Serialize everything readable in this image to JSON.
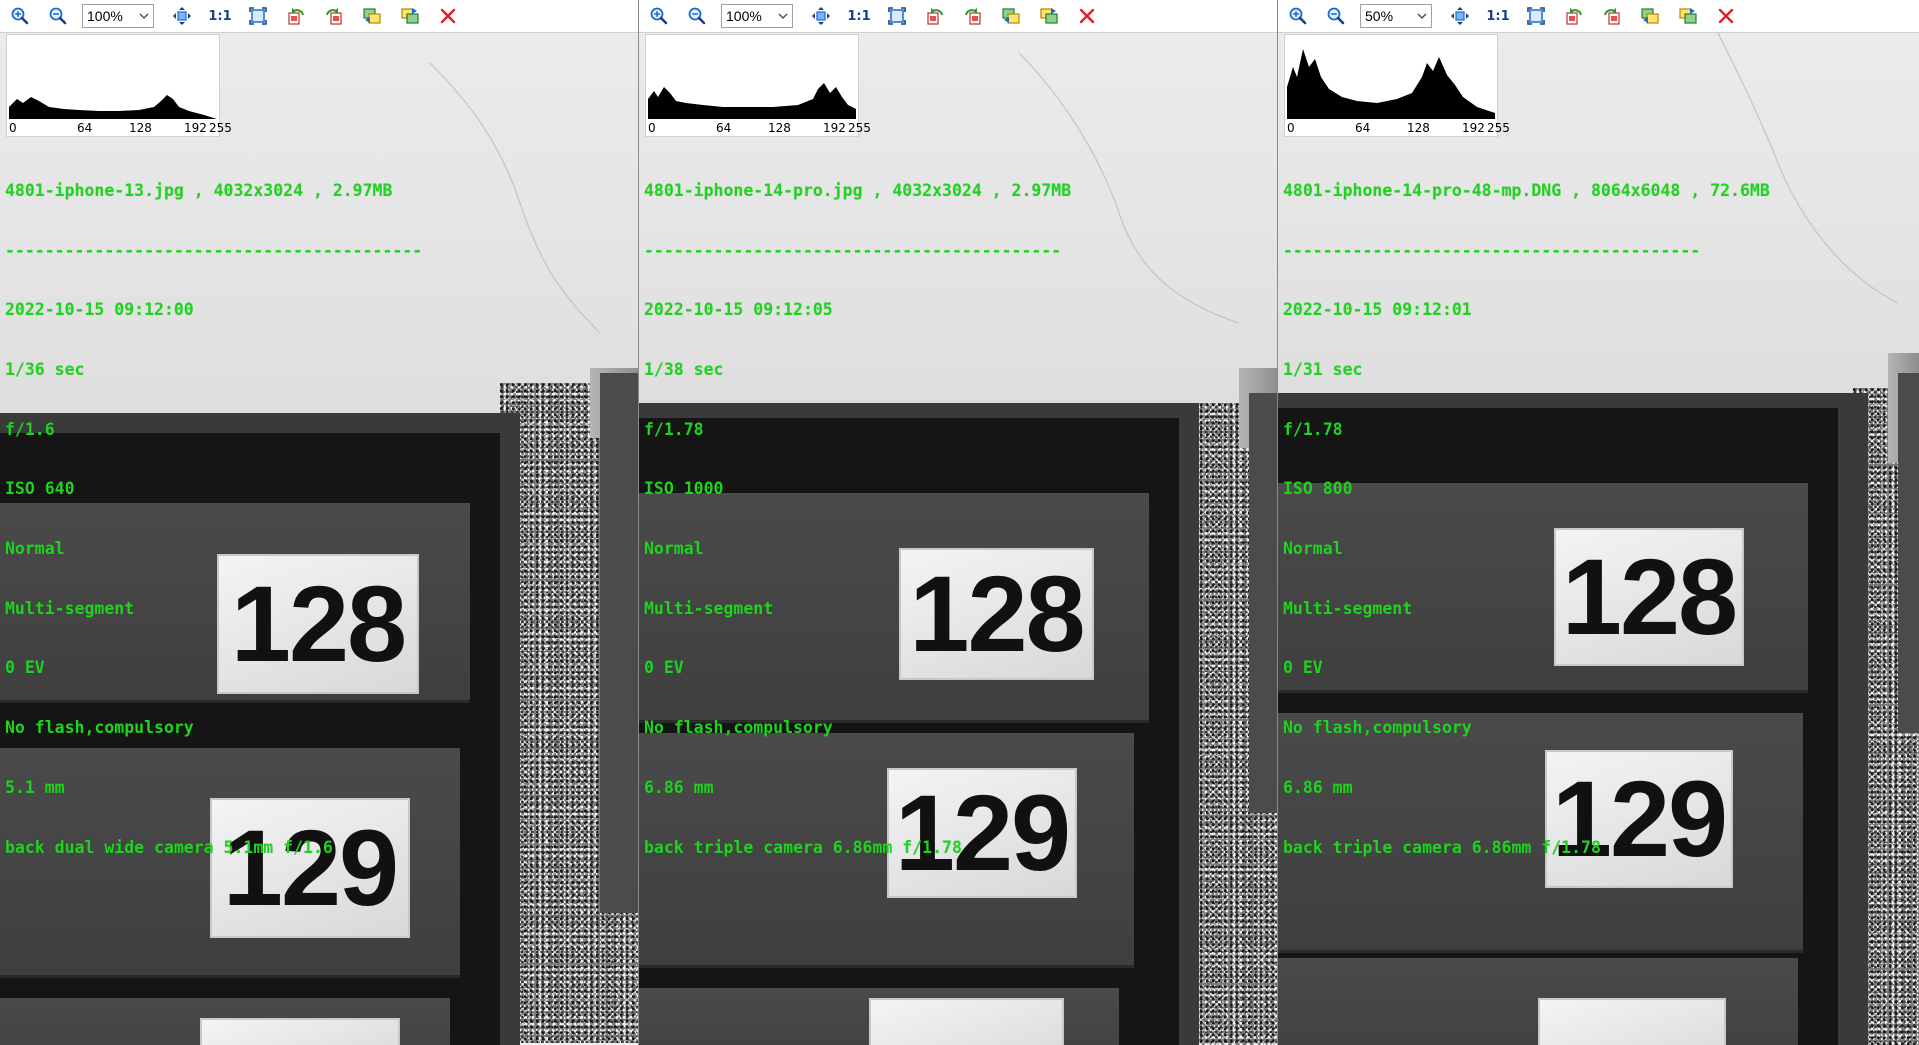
{
  "colors": {
    "overlay_text": "#1ed41e",
    "close_icon": "#e02020",
    "zoom_icon": "#1a6bd1"
  },
  "icons": [
    "zoom-in-icon",
    "zoom-out-icon",
    "fit-center-icon",
    "actual-size-icon",
    "fit-window-icon",
    "rotate-left-icon",
    "rotate-right-icon",
    "sync-left-icon",
    "sync-right-icon",
    "close-icon"
  ],
  "panes": [
    {
      "toolbar": {
        "zoom_value": "100%",
        "actual_size_label": "1:1"
      },
      "histogram": {
        "ticks": [
          "0",
          "64",
          "128",
          "192",
          "255"
        ]
      },
      "exif": {
        "file_line": "4801-iphone-13.jpg , 4032x3024 , 2.97MB",
        "separator": "------------------------------------------",
        "datetime": "2022-10-15 09:12:00",
        "shutter": "1/36 sec",
        "aperture": "f/1.6",
        "iso": "ISO 640",
        "mode": "Normal",
        "metering": "Multi-segment",
        "ev": "0 EV",
        "flash": "No flash,compulsory",
        "focal": "5.1 mm",
        "lens": "back dual wide camera 5.1mm f/1.6"
      },
      "plates": [
        "128",
        "129"
      ]
    },
    {
      "toolbar": {
        "zoom_value": "100%",
        "actual_size_label": "1:1"
      },
      "histogram": {
        "ticks": [
          "0",
          "64",
          "128",
          "192",
          "255"
        ]
      },
      "exif": {
        "file_line": "4801-iphone-14-pro.jpg , 4032x3024 , 2.97MB",
        "separator": "------------------------------------------",
        "datetime": "2022-10-15 09:12:05",
        "shutter": "1/38 sec",
        "aperture": "f/1.78",
        "iso": "ISO 1000",
        "mode": "Normal",
        "metering": "Multi-segment",
        "ev": "0 EV",
        "flash": "No flash,compulsory",
        "focal": "6.86 mm",
        "lens": "back triple camera 6.86mm f/1.78"
      },
      "plates": [
        "128",
        "129"
      ]
    },
    {
      "toolbar": {
        "zoom_value": "50%",
        "actual_size_label": "1:1"
      },
      "histogram": {
        "ticks": [
          "0",
          "64",
          "128",
          "192",
          "255"
        ]
      },
      "exif": {
        "file_line": "4801-iphone-14-pro-48-mp.DNG , 8064x6048 , 72.6MB",
        "separator": "------------------------------------------",
        "datetime": "2022-10-15 09:12:01",
        "shutter": "1/31 sec",
        "aperture": "f/1.78",
        "iso": "ISO 800",
        "mode": "Normal",
        "metering": "Multi-segment",
        "ev": "0 EV",
        "flash": "No flash,compulsory",
        "focal": "6.86 mm",
        "lens": "back triple camera 6.86mm f/1.78"
      },
      "plates": [
        "128",
        "129"
      ]
    }
  ]
}
